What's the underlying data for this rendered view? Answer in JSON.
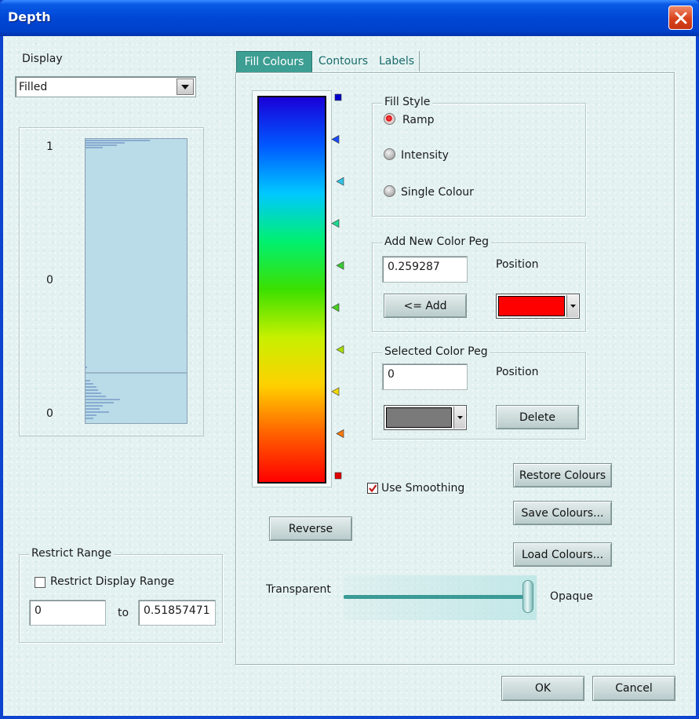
{
  "window": {
    "title": "Depth"
  },
  "display": {
    "label": "Display",
    "selected": "Filled",
    "histogram_labels": [
      "1",
      "0",
      "0"
    ]
  },
  "tabs": [
    {
      "label": "Fill Colours",
      "active": true
    },
    {
      "label": "Contours",
      "active": false
    },
    {
      "label": "Labels",
      "active": false
    }
  ],
  "ramp": {
    "gradient_colors": [
      "#1a00d8",
      "#0058ff",
      "#00c8ff",
      "#00f070",
      "#3ce000",
      "#c8f000",
      "#ffd000",
      "#ff6000",
      "#ff0000"
    ],
    "pegs": [
      {
        "color": "#0000cc",
        "shape": "square"
      },
      {
        "color": "#1a4cff",
        "shape": "triangle"
      },
      {
        "color": "#2ec4e6",
        "shape": "triangle"
      },
      {
        "color": "#20d890",
        "shape": "triangle"
      },
      {
        "color": "#38cc30",
        "shape": "triangle"
      },
      {
        "color": "#48d020",
        "shape": "triangle"
      },
      {
        "color": "#a8e000",
        "shape": "triangle"
      },
      {
        "color": "#f0d800",
        "shape": "triangle"
      },
      {
        "color": "#ff7a10",
        "shape": "triangle"
      },
      {
        "color": "#e00000",
        "shape": "square"
      }
    ],
    "reverse_label": "Reverse"
  },
  "fill_style": {
    "title": "Fill Style",
    "options": [
      "Ramp",
      "Intensity",
      "Single Colour"
    ],
    "selected": "Ramp"
  },
  "add_peg": {
    "title": "Add New Color Peg",
    "value": "0.259287",
    "position_label": "Position",
    "add_label": "<= Add",
    "color": "#ff0000"
  },
  "selected_peg": {
    "title": "Selected Color Peg",
    "value": "0",
    "position_label": "Position",
    "color": "#7a7a7a",
    "delete_label": "Delete"
  },
  "smoothing": {
    "label": "Use Smoothing",
    "checked": true
  },
  "buttons": {
    "restore": "Restore  Colours",
    "save": "Save Colours...",
    "load": "Load Colours...",
    "ok": "OK",
    "cancel": "Cancel"
  },
  "transparency": {
    "left_label": "Transparent",
    "right_label": "Opaque",
    "level": 1.0
  },
  "restrict": {
    "title": "Restrict Range",
    "checkbox_label": "Restrict Display Range",
    "checked": false,
    "min": "0",
    "to_label": "to",
    "max": "0.51857471"
  }
}
